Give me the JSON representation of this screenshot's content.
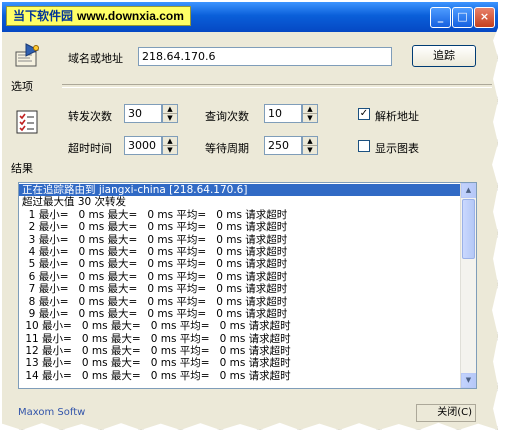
{
  "watermark": {
    "brand": "当下软件园",
    "site": "www.downxia.com"
  },
  "window_buttons": {
    "minimize": "_",
    "maximize": "□",
    "close": "×"
  },
  "sidebar": {
    "options_label": "选项",
    "results_label": "结果"
  },
  "address": {
    "label": "域名或地址",
    "value": "218.64.170.6",
    "button": "追踪"
  },
  "params": {
    "hops_label": "转发次数",
    "hops_value": "30",
    "queries_label": "查询次数",
    "queries_value": "10",
    "timeout_label": "超时时间",
    "timeout_value": "3000",
    "wait_label": "等待周期",
    "wait_value": "250",
    "resolve_label": "解析地址",
    "resolve_checked": true,
    "chart_label": "显示图表",
    "chart_checked": false
  },
  "icons": [
    "network-options-icon",
    "checklist-icon",
    "spin-up-icon",
    "spin-down-icon",
    "scroll-up-icon",
    "scroll-down-icon"
  ],
  "results": {
    "lines": [
      "正在追踪路由到 jiangxi-china [218.64.170.6]",
      "超过最大值 30 次转发",
      "  1 最小=   0 ms 最大=   0 ms 平均=   0 ms 请求超时",
      "  2 最小=   0 ms 最大=   0 ms 平均=   0 ms 请求超时",
      "  3 最小=   0 ms 最大=   0 ms 平均=   0 ms 请求超时",
      "  4 最小=   0 ms 最大=   0 ms 平均=   0 ms 请求超时",
      "  5 最小=   0 ms 最大=   0 ms 平均=   0 ms 请求超时",
      "  6 最小=   0 ms 最大=   0 ms 平均=   0 ms 请求超时",
      "  7 最小=   0 ms 最大=   0 ms 平均=   0 ms 请求超时",
      "  8 最小=   0 ms 最大=   0 ms 平均=   0 ms 请求超时",
      "  9 最小=   0 ms 最大=   0 ms 平均=   0 ms 请求超时",
      " 10 最小=   0 ms 最大=   0 ms 平均=   0 ms 请求超时",
      " 11 最小=   0 ms 最大=   0 ms 平均=   0 ms 请求超时",
      " 12 最小=   0 ms 最大=   0 ms 平均=   0 ms 请求超时",
      " 13 最小=   0 ms 最大=   0 ms 平均=   0 ms 请求超时",
      " 14 最小=   0 ms 最大=   0 ms 平均=   0 ms 请求超时"
    ]
  },
  "status": {
    "text": "Maxom Softw",
    "button": "关闭(C)"
  }
}
